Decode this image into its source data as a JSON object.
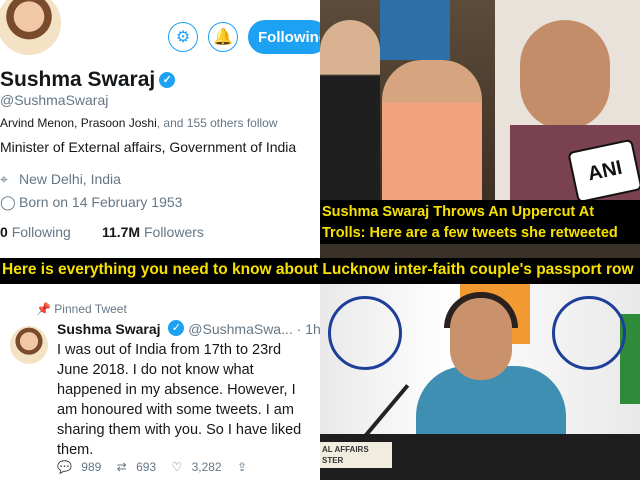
{
  "profile": {
    "follow_button": "Following",
    "name": "Sushma Swaraj",
    "handle": "@SushmaSwaraj",
    "followed_by_names": "Arvind Menon, Prasoon Joshi",
    "followed_by_rest": ", and 155 others follow",
    "bio": "Minister of External affairs, Government of India",
    "location": "New Delhi, India",
    "birthday": "Born on 14 February 1953",
    "following_count": "0",
    "following_label": "Following",
    "followers_count": "11.7M",
    "followers_label": "Followers"
  },
  "photo1": {
    "door_label": "",
    "mic_label": "ANI",
    "caption": "Sushma Swaraj Throws An Uppercut At Trolls: Here are a few tweets she retweeted"
  },
  "banner": {
    "text": "Here is everything you need to know about Lucknow inter-faith couple's passport row"
  },
  "tweet": {
    "pinned_label": "Pinned Tweet",
    "name": "Sushma Swaraj",
    "handle": "@SushmaSwa... · 1h",
    "body": "I was out of India from 17th to 23rd June 2018. I do not know what happened in my absence. However, I am honoured with some tweets. I am sharing them with you. So I have liked them.",
    "replies": "989",
    "retweets": "693",
    "likes": "3,282"
  },
  "photo2": {
    "podium_label": "AL AFFAIRS\nSTER"
  }
}
